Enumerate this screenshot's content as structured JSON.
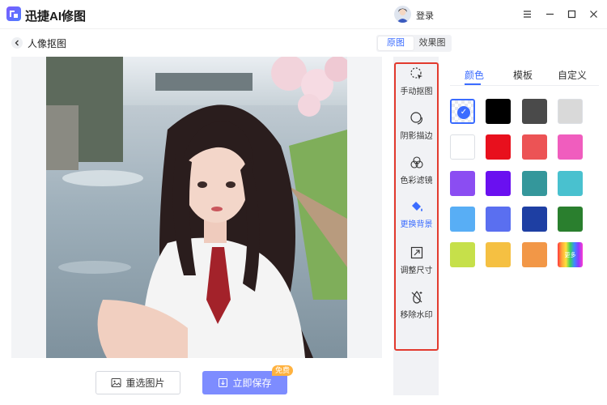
{
  "app": {
    "title": "迅捷AI修图",
    "login_label": "登录"
  },
  "window_controls": [
    "menu-icon",
    "minimize-icon",
    "maximize-icon",
    "close-icon"
  ],
  "page": {
    "title": "人像抠图"
  },
  "view_toggle": {
    "original": "原图",
    "result": "效果图",
    "active": "original"
  },
  "actions": {
    "reselect_label": "重选图片",
    "save_label": "立即保存",
    "save_badge": "免费"
  },
  "tools": [
    {
      "id": "manual-cutout",
      "label": "手动抠图",
      "icon": "magic-cursor-icon"
    },
    {
      "id": "shadow-outline",
      "label": "阴影描边",
      "icon": "shadow-circle-icon"
    },
    {
      "id": "color-filter",
      "label": "色彩滤镜",
      "icon": "color-circles-icon"
    },
    {
      "id": "change-background",
      "label": "更换背景",
      "icon": "paint-bucket-icon",
      "active": true
    },
    {
      "id": "resize",
      "label": "调整尺寸",
      "icon": "resize-icon"
    },
    {
      "id": "remove-watermark",
      "label": "移除水印",
      "icon": "remove-watermark-icon"
    }
  ],
  "panel": {
    "tabs": [
      {
        "label": "颜色",
        "active": true
      },
      {
        "label": "模板",
        "active": false
      },
      {
        "label": "自定义",
        "active": false
      }
    ],
    "selected_swatch": "transparent",
    "swatches": [
      "transparent",
      "#000000",
      "#4a4a4a",
      "#d9d9d9",
      "#ffffff",
      "#e8101d",
      "#ec5355",
      "#f05dbe",
      "#8b4df2",
      "#6a10f0",
      "#34979b",
      "#49c1cf",
      "#58aef5",
      "#5a6ff0",
      "#1e3fa3",
      "#2a7f2e",
      "#c6e04a",
      "#f5c042",
      "#f29747",
      "rainbow"
    ],
    "rainbow_text": "更多"
  }
}
